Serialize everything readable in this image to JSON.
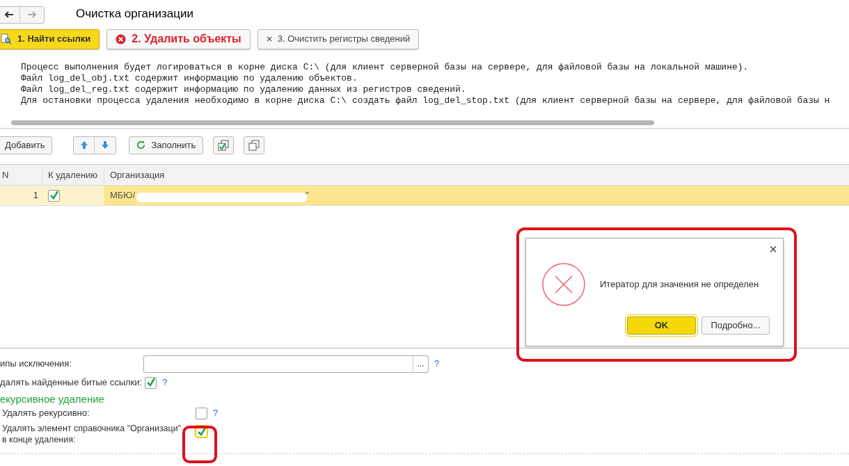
{
  "window": {
    "title": "Очистка организации"
  },
  "steps": [
    {
      "label": "1. Найти ссылки",
      "kind": "search",
      "selected": true
    },
    {
      "label": "2. Удалить объекты",
      "kind": "error",
      "selected": false
    },
    {
      "label": "3. Очистить регистры сведений",
      "kind": "cross",
      "selected": false
    }
  ],
  "log_lines": [
    "Процесс выполнения будет логироваться в корне диска C:\\ (для клиент серверной базы на сервере, для файловой базы на локальной машине).",
    "Файл log_del_obj.txt содержит информацию по удалению объектов.",
    "Файл log_del_reg.txt содержит информацию по удалению данных из регистров сведений.",
    "Для остановки процесса удаления необходимо в корне диска C:\\ создать файл log_del_stop.txt (для клиент серверной базы на сервере, для файловой базы н"
  ],
  "toolbar": {
    "add": "Добавить",
    "fill": "Заполнить"
  },
  "table": {
    "columns": [
      "N",
      "К удалению",
      "Организация"
    ],
    "rows": [
      {
        "n": "1",
        "checked": true,
        "org_start": "МБЮ/",
        "org_end": "\"",
        "selected": true
      }
    ]
  },
  "form": {
    "exclusion_label": "ипы исключения:",
    "exclusion_button": "...",
    "help": "?",
    "broken_label": "далять найденные битые ссылки:",
    "broken_checked": true,
    "section": "екурсивное удаление",
    "recursive_label": "Удалять рекурсивно:",
    "recursive_checked": false,
    "element_label": "Удалять элемент справочника \"Организаци\"",
    "element_label_2": "в конце удаления:",
    "element_checked": true
  },
  "dialog": {
    "message": "Итератор для значения не определен",
    "close": "×",
    "buttons": [
      {
        "label": "OK",
        "selected": true
      },
      {
        "label": "Подробно...",
        "selected": false
      }
    ]
  }
}
